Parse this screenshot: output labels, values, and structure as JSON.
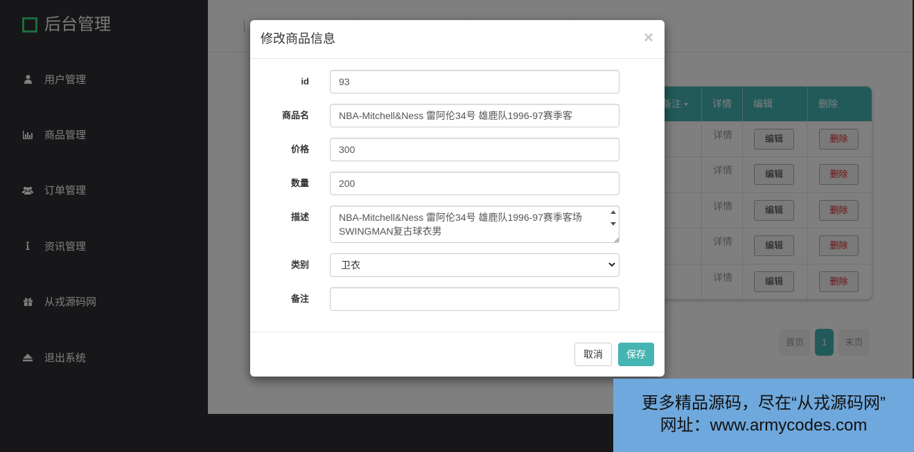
{
  "sidebar": {
    "logo_text": "后台管理",
    "logo_icon": "square-logo-icon",
    "items": [
      {
        "label": "用户管理",
        "icon": "user-icon"
      },
      {
        "label": "商品管理",
        "icon": "bar-chart-icon"
      },
      {
        "label": "订单管理",
        "icon": "users-icon"
      },
      {
        "label": "资讯管理",
        "icon": "info-icon"
      },
      {
        "label": "从戎源码网",
        "icon": "gift-icon"
      },
      {
        "label": "退出系统",
        "icon": "eject-icon"
      }
    ]
  },
  "table": {
    "columns": {
      "remark": "备注",
      "detail": "详情",
      "edit": "编辑",
      "delete": "删除"
    },
    "rows": [
      {
        "detail": "详情",
        "edit": "编辑",
        "delete": "删除"
      },
      {
        "detail": "详情",
        "edit": "编辑",
        "delete": "删除"
      },
      {
        "detail": "详情",
        "edit": "编辑",
        "delete": "删除"
      },
      {
        "detail": "详情",
        "edit": "编辑",
        "delete": "删除"
      },
      {
        "detail": "详情",
        "edit": "编辑",
        "delete": "删除"
      }
    ]
  },
  "pagination": {
    "first": "首页",
    "current": "1",
    "last": "末页"
  },
  "modal": {
    "title": "修改商品信息",
    "close": "×",
    "fields": {
      "id": {
        "label": "id",
        "value": "93"
      },
      "name": {
        "label": "商品名",
        "value": "NBA-Mitchell&Ness 雷阿伦34号 雄鹿队1996-97赛季客"
      },
      "price": {
        "label": "价格",
        "value": "300"
      },
      "quantity": {
        "label": "数量",
        "value": "200"
      },
      "description": {
        "label": "描述",
        "value": "NBA-Mitchell&Ness 雷阿伦34号 雄鹿队1996-97赛季客场\nSWINGMAN复古球衣男"
      },
      "category": {
        "label": "类别",
        "value": "卫衣"
      },
      "remark": {
        "label": "备注",
        "value": ""
      }
    },
    "buttons": {
      "cancel": "取消",
      "save": "保存"
    }
  },
  "watermark": {
    "line1": "更多精品源码，尽在“从戎源码网”",
    "line2": "网址：www.armycodes.com"
  },
  "colors": {
    "accent": "#45b5b3",
    "sidebar_bg": "#2e2e32",
    "danger": "#e52222",
    "watermark_bg": "#6fa8dc",
    "logo_green": "#38d97f"
  }
}
